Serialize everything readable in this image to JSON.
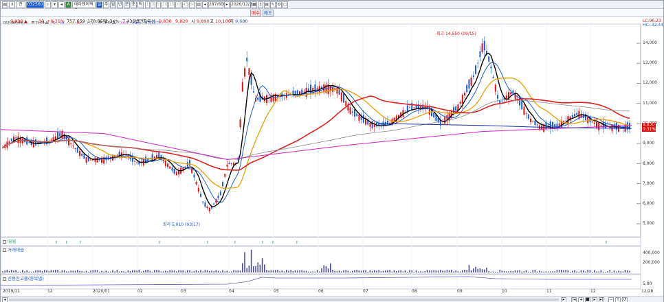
{
  "toolbar": {
    "code": "032560",
    "name": "테라젠이텍스",
    "date": "2020/12/28",
    "count": "287/600",
    "periods": [
      "1",
      "3",
      "5",
      "10",
      "15",
      "30",
      "45",
      "60"
    ],
    "day_week_month": [
      "주",
      "월",
      "년",
      "분",
      "초",
      "틱"
    ]
  },
  "quote": {
    "price": "9,830",
    "change": "30",
    "change_pct": "+0.31%",
    "volume": "757,659",
    "amount": "178.85억",
    "vol_ratio": "2.34%",
    "shares": "7,436백만",
    "ask_label": "최우선",
    "ask1": "9,830",
    "ask2": "9,820",
    "open_label": "시",
    "open": "9,890",
    "high_label": "고",
    "high": "10,100",
    "low_label": "저",
    "low": "9,680",
    "buy": "매수",
    "sell": "매도",
    "up_arrow": "▲"
  },
  "legend": {
    "stock": "테라젠이텍스",
    "ma_label1": "종가 단순",
    "ma1": "5",
    "ma2": "10",
    "ma3": "20",
    "ma4": "60",
    "ma5": "120",
    "ma_label2": "종가 단순",
    "ma6": "240",
    "ma7": "480",
    "extra": "거래대금"
  },
  "right_top": {
    "line1": "LC:96.23",
    "line2": "HC:-32.44"
  },
  "price_axis": [
    "14,000",
    "13,000",
    "12,000",
    "11,000",
    "10,000",
    "9,000",
    "8,000",
    "7,000",
    "6,000",
    "5,000"
  ],
  "current_price_tag": {
    "price": "9,830",
    "pct": "0.31%"
  },
  "annotations": {
    "high": "최고 14,550 (09/15)",
    "low": "최저 5,010 (03/17)"
  },
  "panes": {
    "p1": {
      "title": "매매",
      "ticks": []
    },
    "p2": {
      "title": "거래대금",
      "ticks": [
        "400,000",
        "200,000"
      ]
    },
    "p3": {
      "title": "신용잔고율(종목별)",
      "ticks": [
        "5.00"
      ]
    }
  },
  "x_axis": [
    "2019/11",
    "12",
    "2020/01",
    "02",
    "03",
    "04",
    "05",
    "06",
    "07",
    "08",
    "09",
    "10",
    "11",
    "12",
    "12/28"
  ],
  "colors": {
    "up": "#e01010",
    "down": "#1a5bd6",
    "ma5": "#000000",
    "ma10": "#1a5bd6",
    "ma20": "#e8a000",
    "ma60": "#e02020",
    "ma120": "#888888",
    "ma240": "#d020c0",
    "ma480": "#1a2fa0"
  }
}
